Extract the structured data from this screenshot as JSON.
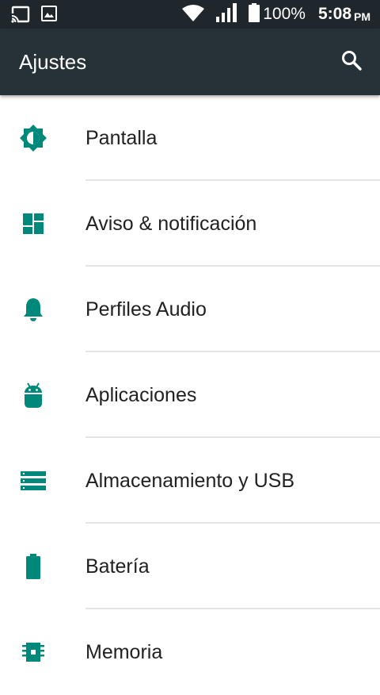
{
  "colors": {
    "status_bar": "#1f272c",
    "app_bar": "#263238",
    "accent": "#00897b",
    "text": "#212121",
    "divider": "#e3e3e3"
  },
  "status": {
    "battery": "100%",
    "time": "5:08",
    "ampm": "PM",
    "battery_level": 1.0,
    "icons": [
      "cast-icon",
      "image-icon",
      "wifi-icon",
      "signal-icon",
      "battery-icon"
    ]
  },
  "app_bar": {
    "title": "Ajustes",
    "search_icon": "search-icon"
  },
  "settings": [
    {
      "label": "Pantalla",
      "icon": "brightness-icon"
    },
    {
      "label": "Aviso & notificación",
      "icon": "dashboard-icon"
    },
    {
      "label": "Perfiles Audio",
      "icon": "bell-icon"
    },
    {
      "label": "Aplicaciones",
      "icon": "android-icon"
    },
    {
      "label": "Almacenamiento y USB",
      "icon": "storage-icon"
    },
    {
      "label": "Batería",
      "icon": "battery-full-icon"
    },
    {
      "label": "Memoria",
      "icon": "memory-icon"
    }
  ]
}
